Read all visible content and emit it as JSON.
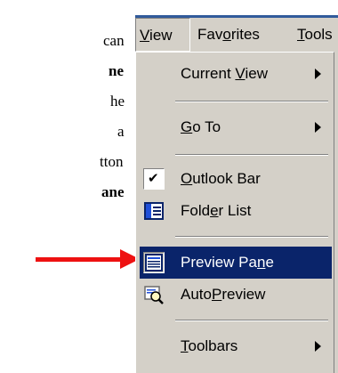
{
  "doc": {
    "lines": [
      "can",
      "ne",
      "he",
      "a",
      "tton",
      "ane"
    ],
    "bold": [
      false,
      true,
      false,
      false,
      false,
      true
    ]
  },
  "colors": {
    "arrow": "#ee1111",
    "highlight": "#0a246a",
    "menu_bg": "#d4d0c8"
  },
  "menubar": {
    "view": {
      "pre": "",
      "u": "V",
      "post": "iew"
    },
    "favorites": {
      "pre": "Fav",
      "u": "o",
      "post": "rites"
    },
    "tools": {
      "pre": "",
      "u": "T",
      "post": "ools"
    }
  },
  "menu": {
    "current_view": {
      "pre": "Current ",
      "u": "V",
      "post": "iew"
    },
    "go_to": {
      "pre": "",
      "u": "G",
      "post": "o To"
    },
    "outlook_bar": {
      "pre": "",
      "u": "O",
      "post": "utlook Bar",
      "checked": true
    },
    "folder_list": {
      "pre": "Fold",
      "u": "e",
      "post": "r List"
    },
    "preview_pane": {
      "pre": "Preview Pa",
      "u": "n",
      "post": "e",
      "highlighted": true
    },
    "autopreview": {
      "pre": "Auto",
      "u": "P",
      "post": "review"
    },
    "toolbars": {
      "pre": "",
      "u": "T",
      "post": "oolbars"
    }
  },
  "icons": {
    "check": "check-icon",
    "folder_list": "folder-list-icon",
    "preview_pane": "preview-pane-icon",
    "autopreview": "autopreview-icon"
  }
}
